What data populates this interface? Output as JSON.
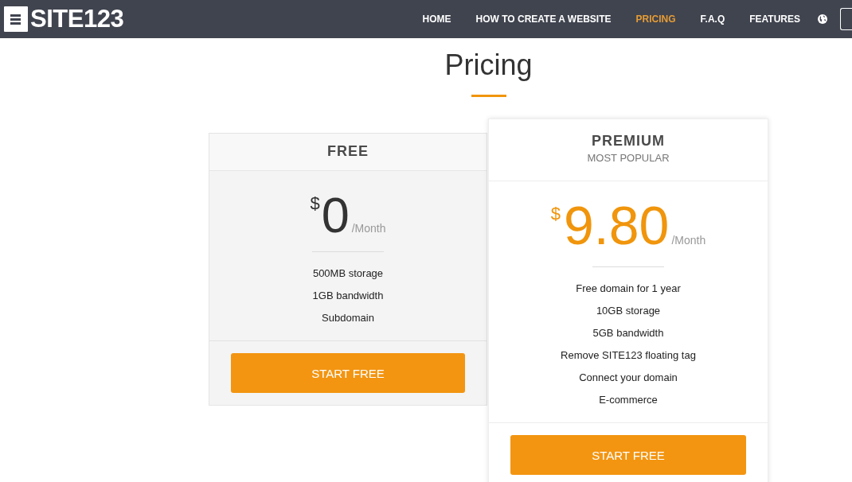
{
  "header": {
    "logo": "SITE123",
    "nav": [
      {
        "label": "HOME",
        "selected": false
      },
      {
        "label": "HOW TO CREATE A WEBSITE",
        "selected": false
      },
      {
        "label": "PRICING",
        "selected": true
      },
      {
        "label": "F.A.Q",
        "selected": false
      },
      {
        "label": "FEATURES",
        "selected": false
      }
    ]
  },
  "title": "Pricing",
  "plans": [
    {
      "name": "FREE",
      "featured": false,
      "currency": "$",
      "price": "0",
      "period": "/Month",
      "features": [
        "500MB storage",
        "1GB bandwidth",
        "Subdomain"
      ],
      "button": "START FREE"
    },
    {
      "name": "PREMIUM",
      "subtitle": "MOST POPULAR",
      "featured": true,
      "currency": "$",
      "price": "9.80",
      "period": "/Month",
      "features": [
        "Free domain for 1 year",
        "10GB storage",
        "5GB bandwidth",
        "Remove SITE123 floating tag",
        "Connect your domain",
        "E-commerce"
      ],
      "button": "START FREE"
    }
  ]
}
